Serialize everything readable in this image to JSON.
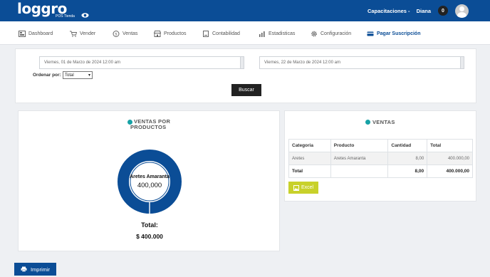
{
  "brand": {
    "logo_text": "loggro",
    "logo_sub": "POS Tienda"
  },
  "header": {
    "capacitaciones": "Capacitaciones -",
    "user_name": "Diana",
    "notifications": "0"
  },
  "nav": {
    "dashboard": "Dashboard",
    "vender": "Vender",
    "ventas": "Ventas",
    "productos": "Productos",
    "contabilidad": "Contabilidad",
    "estadisticas": "Estadisticas",
    "configuracion": "Configuración",
    "pagar": "Pagar Suscripción"
  },
  "filters": {
    "start_date": "Viernes, 01 de Marzo de 2024 12:00 am",
    "end_date": "Viernes, 22 de Marzo de 2024 12:00 am",
    "sort_label": "Ordenar por:",
    "sort_value": "Total",
    "search_button": "Buscar"
  },
  "products_card": {
    "title_line1": "VENTAS POR",
    "title_line2": "PRODUCTOS",
    "total_label": "Total:",
    "total_value": "$ 400.000"
  },
  "chart_data": {
    "type": "pie",
    "categories": [
      "Aretes Amaranta"
    ],
    "values": [
      400000
    ],
    "value_labels": [
      "400,000"
    ],
    "colors": [
      "#0b4d96"
    ]
  },
  "sales_card": {
    "title": "VENTAS",
    "columns": [
      "Categoria",
      "Producto",
      "Cantidad",
      "Total"
    ],
    "rows": [
      {
        "categoria": "Aretes",
        "producto": "Aretes Amaranta",
        "cantidad": "8,00",
        "total": "400.000,00"
      }
    ],
    "total_row": {
      "label": "Total",
      "cantidad": "8,00",
      "total": "400.000,00"
    },
    "excel_button": "Excel"
  },
  "print_button": "Imprimir",
  "colors": {
    "primary": "#0b4d96",
    "teal": "#17a2a6",
    "excel": "#c8d12b"
  }
}
